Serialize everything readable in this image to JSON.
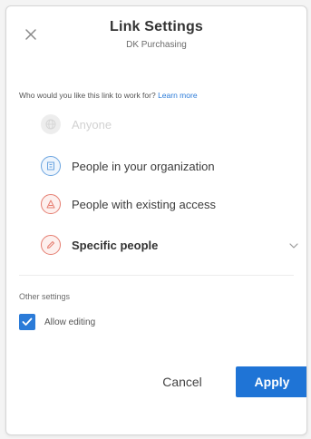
{
  "dialog": {
    "title": "Link Settings",
    "subtitle": "DK Purchasing",
    "close_icon": "close-icon"
  },
  "question": {
    "text": "Who would you like this link to work for?",
    "learn_more": "Learn more"
  },
  "options": [
    {
      "label": "Anyone",
      "icon": "globe-icon",
      "state": "disabled"
    },
    {
      "label": "People in your organization",
      "icon": "building-icon",
      "state": "enabled"
    },
    {
      "label": "People with existing access",
      "icon": "people-icon",
      "state": "enabled"
    },
    {
      "label": "Specific people",
      "icon": "pencil-icon",
      "state": "selected"
    }
  ],
  "other_settings": {
    "label": "Other settings",
    "allow_editing": {
      "label": "Allow editing",
      "checked": true
    }
  },
  "footer": {
    "cancel_label": "Cancel",
    "apply_label": "Apply"
  },
  "colors": {
    "accent": "#1f74d6",
    "link": "#2b7bd8",
    "org_icon": "#6aa4e0",
    "warning_icon": "#e57c6f"
  }
}
